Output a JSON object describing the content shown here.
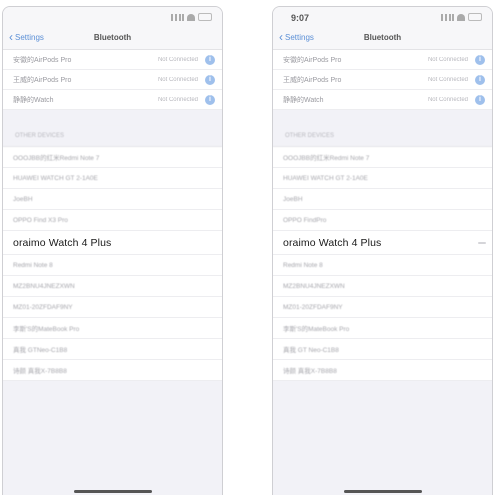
{
  "screens": [
    {
      "time": "",
      "back_label": "Settings",
      "title": "Bluetooth",
      "my_devices": [
        {
          "name": "安徽的AirPods Pro",
          "status": "Not Connected"
        },
        {
          "name": "王威的AirPods Pro",
          "status": "Not Connected"
        },
        {
          "name": "静静的Watch",
          "status": "Not Connected"
        }
      ],
      "other_devices_header": "OTHER DEVICES",
      "other_devices": [
        "OOOJBB的红米Redmi Note 7",
        "HUAWEI WATCH GT 2-1A0E",
        "JoeBH",
        "OPPO Find X3 Pro",
        "oraimo Watch 4 Plus",
        "Redmi Note 8",
        "MZ2BNU4JNEZXWN",
        "MZ01-20ZFDAF9NY",
        "李斯'S的MateBook Pro",
        "真我 GTNeo-C1B8",
        "诗颜 真我X-7B8B8"
      ]
    },
    {
      "time": "9:07",
      "back_label": "Settings",
      "title": "Bluetooth",
      "my_devices": [
        {
          "name": "安徽的AirPods Pro",
          "status": "Not Connected"
        },
        {
          "name": "王威的AirPods Pro",
          "status": "Not Connected"
        },
        {
          "name": "静静的Watch",
          "status": "Not Connected"
        }
      ],
      "other_devices_header": "OTHER DEVICES",
      "other_devices": [
        "OOOJBB的红米Redmi Note 7",
        "HUAWEI WATCH GT 2-1A0E",
        "JoeBH",
        "OPPO FindPro",
        "oraimo Watch 4 Plus",
        "Redmi Note 8",
        "MZ2BNU4JNEZXWN",
        "MZ01-20ZFDAF9NY",
        "李斯'S的MateBook Pro",
        "真我 GT Neo-C1B8",
        "诗颜 真我X-7B8B8"
      ]
    }
  ],
  "highlighted_device": "oraimo Watch 4 Plus",
  "colors": {
    "accent": "#5b8fd6",
    "info": "#9fc0ec",
    "background": "#f2f2f7"
  }
}
